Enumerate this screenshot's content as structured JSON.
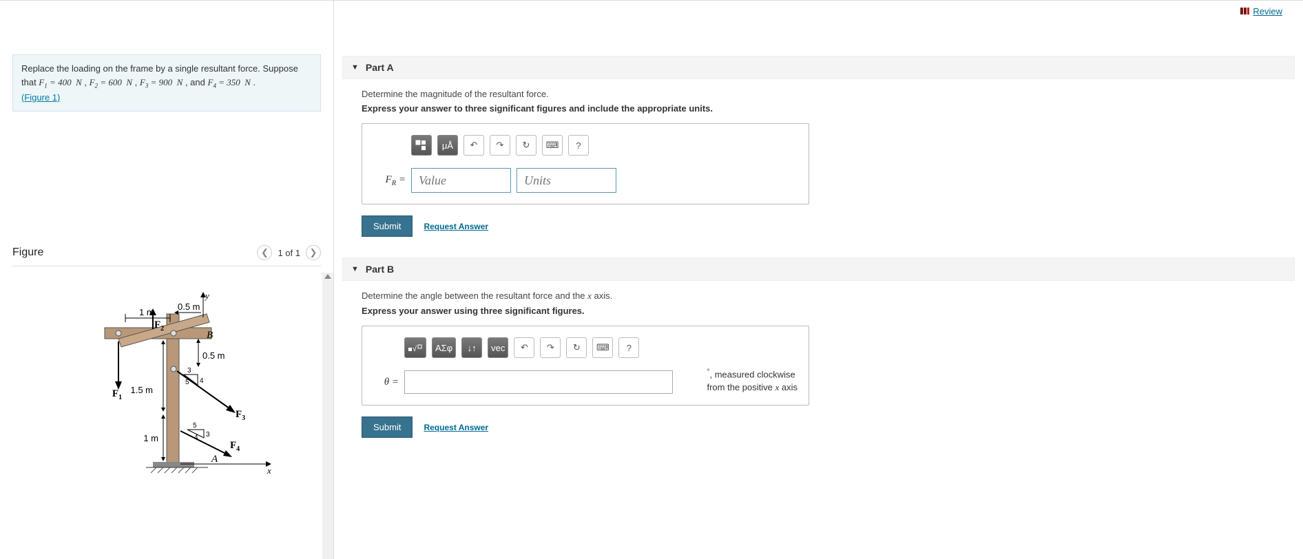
{
  "review_label": "Review",
  "problem": {
    "intro": "Replace the loading on the frame by a single resultant force. Suppose that ",
    "f1": "F₁ = 400  N",
    "f2": "F₂ = 600  N",
    "f3": "F₃ = 900  N",
    "f4": "F₄ = 350  N",
    "figure_link": "(Figure 1)"
  },
  "figure": {
    "title": "Figure",
    "count": "1 of 1",
    "labels": {
      "y": "y",
      "x": "x",
      "B": "B",
      "A": "A",
      "m1": "1 m",
      "m05a": "0.5 m",
      "m05b": "0.5 m",
      "m15": "1.5 m",
      "m1b": "1 m",
      "F1": "F",
      "F2": "F",
      "F3": "F",
      "F4": "F",
      "s3": "3",
      "s4": "4",
      "s5": "5",
      "t3": "3",
      "t4": "4",
      "t5": "5"
    }
  },
  "partA": {
    "title": "Part A",
    "prompt": "Determine the magnitude of the resultant force.",
    "instruction": "Express your answer to three significant figures and include the appropriate units.",
    "toolbar": {
      "templates": "▫▫",
      "mu": "μÅ",
      "undo": "↶",
      "redo": "↷",
      "reset": "↻",
      "kb": "⌨",
      "help": "?"
    },
    "label": "FR =",
    "value_ph": "Value",
    "units_ph": "Units",
    "submit": "Submit",
    "request": "Request Answer"
  },
  "partB": {
    "title": "Part B",
    "prompt_pre": "Determine the angle between the resultant force and the ",
    "prompt_x": "x",
    "prompt_post": " axis.",
    "instruction": "Express your answer using three significant figures.",
    "toolbar": {
      "templates": "▫√▫",
      "greek": "ΑΣφ",
      "sort": "↓↑",
      "vec": "vec",
      "undo": "↶",
      "redo": "↷",
      "reset": "↻",
      "kb": "⌨",
      "help": "?"
    },
    "label": "θ =",
    "suffix_deg": "°",
    "suffix_text1": ", measured clockwise",
    "suffix_text2": "from the positive ",
    "suffix_x": "x",
    "suffix_text3": " axis",
    "submit": "Submit",
    "request": "Request Answer"
  }
}
